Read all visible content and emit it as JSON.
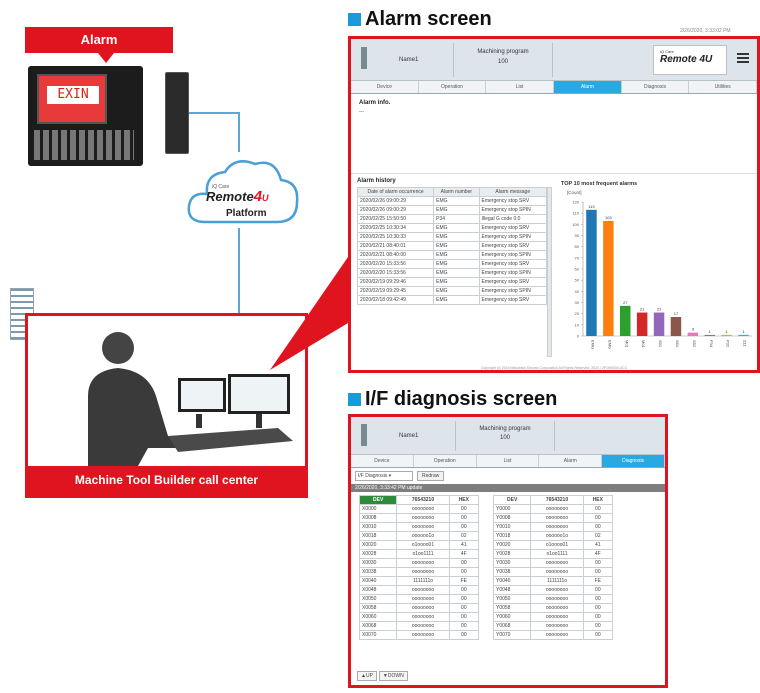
{
  "alarm_label": "Alarm",
  "exin_text": "EXIN",
  "cloud": {
    "brand_small": "iQ Care",
    "brand": "Remote",
    "brand_num": "4",
    "brand_u": "U",
    "platform": "Platform"
  },
  "callcenter_label": "Machine Tool Builder call center",
  "alarm_screen": {
    "heading": "Alarm screen",
    "date": "2/26/2020, 3:33:02 PM",
    "name": "Name1",
    "program_label": "Machining program",
    "program_no": "100",
    "logo_small": "iQ Care",
    "logo": "Remote 4U",
    "tabs": [
      "Device",
      "Operation",
      "List",
      "Alarm",
      "Diagnosis",
      "Utilities"
    ],
    "alarm_info": "Alarm info.",
    "alarm_info_value": "---",
    "history_title": "Alarm history",
    "history_cols": [
      "Date of alarm occurrence",
      "Alarm number",
      "Alarm message"
    ],
    "history_rows": [
      [
        "2020/02/26 09:00:29",
        "EMG",
        "Emergency stop SRV"
      ],
      [
        "2020/02/26 09:00:29",
        "EMG",
        "Emergency stop SPIN"
      ],
      [
        "2020/02/25 15:50:50",
        "P34",
        "Illegal G code 0:0"
      ],
      [
        "2020/02/25 10:30:34",
        "EMG",
        "Emergency stop SRV"
      ],
      [
        "2020/02/25 10:30:33",
        "EMG",
        "Emergency stop SPIN"
      ],
      [
        "2020/02/21 08:40:01",
        "EMG",
        "Emergency stop SRV"
      ],
      [
        "2020/02/21 08:40:00",
        "EMG",
        "Emergency stop SPIN"
      ],
      [
        "2020/02/20 15:33:56",
        "EMG",
        "Emergency stop SRV"
      ],
      [
        "2020/02/20 15:33:56",
        "EMG",
        "Emergency stop SPIN"
      ],
      [
        "2020/02/19 09:29:46",
        "EMG",
        "Emergency stop SRV"
      ],
      [
        "2020/02/19 09:29:45",
        "EMG",
        "Emergency stop SPIN"
      ],
      [
        "2020/02/18 09:42:49",
        "EMG",
        "Emergency stop SRV"
      ]
    ],
    "footer": "Copyright (c) 2019 Mitsubishi Electric Corporation All Rights Reserved. 2020 / 2F1M0000-ACC"
  },
  "chart_data": {
    "type": "bar",
    "title": "TOP 10 most frequent alarms",
    "ylabel": "[Count]",
    "categories": [
      "EMG",
      "EMG",
      "M01",
      "M01",
      "S01",
      "S51",
      "S52",
      "P34",
      "P32",
      "Z11"
    ],
    "values": [
      113,
      103,
      27,
      21,
      21,
      17,
      3,
      1,
      1,
      1
    ],
    "colors": [
      "#1f77b4",
      "#ff7f0e",
      "#2ca02c",
      "#d62728",
      "#9467bd",
      "#8c564b",
      "#e377c2",
      "#7f7f7f",
      "#bcbd22",
      "#17becf"
    ],
    "ylim": [
      0,
      120
    ],
    "yticks": [
      0,
      10,
      20,
      30,
      40,
      50,
      60,
      70,
      80,
      90,
      100,
      110,
      120
    ]
  },
  "diag_screen": {
    "heading": "I/F diagnosis screen",
    "name": "Name1",
    "program_label": "Machining program",
    "program_no": "100",
    "tabs": [
      "Device",
      "Operation",
      "List",
      "Alarm",
      "Diagnosis"
    ],
    "select_value": "I/F Diagnosis",
    "redraw": "Redraw",
    "update": "2/26/2020, 3:33:42 PM update",
    "cols": [
      "DEV",
      "76543210",
      "HEX"
    ],
    "left_rows": [
      [
        "X0000",
        "oooooooo",
        "00"
      ],
      [
        "X0008",
        "oooooooo",
        "00"
      ],
      [
        "X0010",
        "oooooooo",
        "00"
      ],
      [
        "X0018",
        "oooooo1o",
        "02"
      ],
      [
        "X0020",
        "o1oooo01",
        "41"
      ],
      [
        "X0028",
        "o1oo1111",
        "4F"
      ],
      [
        "X0030",
        "oooooooo",
        "00"
      ],
      [
        "X0038",
        "oooooooo",
        "00"
      ],
      [
        "X0040",
        "1111111o",
        "FE"
      ],
      [
        "X0048",
        "oooooooo",
        "00"
      ],
      [
        "X0050",
        "oooooooo",
        "00"
      ],
      [
        "X0058",
        "oooooooo",
        "00"
      ],
      [
        "X0060",
        "oooooooo",
        "00"
      ],
      [
        "X0068",
        "oooooooo",
        "00"
      ],
      [
        "X0070",
        "oooooooo",
        "00"
      ]
    ],
    "right_rows": [
      [
        "Y0000",
        "oooooooo",
        "00"
      ],
      [
        "Y0008",
        "oooooooo",
        "00"
      ],
      [
        "Y0010",
        "oooooooo",
        "00"
      ],
      [
        "Y0018",
        "oooooo1o",
        "02"
      ],
      [
        "Y0020",
        "o1oooo01",
        "41"
      ],
      [
        "Y0028",
        "o1oo1111",
        "4F"
      ],
      [
        "Y0030",
        "oooooooo",
        "00"
      ],
      [
        "Y0038",
        "oooooooo",
        "00"
      ],
      [
        "Y0040",
        "1111111o",
        "FE"
      ],
      [
        "Y0048",
        "oooooooo",
        "00"
      ],
      [
        "Y0050",
        "oooooooo",
        "00"
      ],
      [
        "Y0058",
        "oooooooo",
        "00"
      ],
      [
        "Y0060",
        "oooooooo",
        "00"
      ],
      [
        "Y0068",
        "oooooooo",
        "00"
      ],
      [
        "Y0070",
        "oooooooo",
        "00"
      ]
    ],
    "up": "UP",
    "down": "DOWN"
  }
}
